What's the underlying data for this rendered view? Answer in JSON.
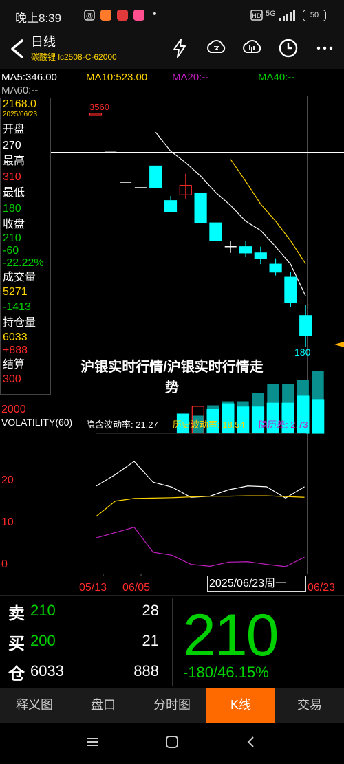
{
  "status": {
    "time": "晚上8:39",
    "network": "5G",
    "battery": "50"
  },
  "header": {
    "title": "日线",
    "subtitle": "碳酸锂 lc2508-C-62000",
    "icons": [
      "back-icon",
      "lightning-icon",
      "cloud-sync-icon",
      "cloud-sync-alt-icon",
      "clock-icon",
      "more-icon"
    ]
  },
  "indicators": {
    "ma5": "MA5:346.00",
    "ma10": "MA10:523.00",
    "ma20": "MA20:--",
    "ma40": "MA40:--",
    "ma60": "MA60:--"
  },
  "info": {
    "price": "2168.0",
    "date": "2025/06/23",
    "open_label": "开盘",
    "open": "270",
    "high_label": "最高",
    "high": "310",
    "low_label": "最低",
    "low": "180",
    "close_label": "收盘",
    "close": "210",
    "change": "-60",
    "change_pct": "-22.22%",
    "volume_label": "成交量",
    "volume": "5271",
    "volume_change": "-1413",
    "oi_label": "持仓量",
    "oi": "6033",
    "oi_change": "+888",
    "settle_label": "结算",
    "settle": "300"
  },
  "chart_labels": {
    "high_marker": "3560",
    "low_marker": "180",
    "volume_level": "2000",
    "vol_title": "VOLATILITY(60)",
    "implied": "隐含波动率: 21.27",
    "historical": "历史波动率: 18.54",
    "spread": "隐历差: 2.73",
    "tick_20": "20",
    "tick_10": "10",
    "tick_0": "0",
    "date_1": "05/13",
    "date_2": "06/05",
    "date_3": "06/23",
    "crosshair_date": "2025/06/23周一"
  },
  "chart_data": {
    "type": "candlestick",
    "candles": [
      {
        "open": 3540,
        "close": 3560,
        "high": 3560,
        "low": 3540
      },
      {
        "open": 2170,
        "close": 2170,
        "high": 2170,
        "low": 2170
      },
      {
        "open": 1480,
        "close": 1480,
        "high": 1480,
        "low": 1480
      },
      {
        "open": 1380,
        "close": 1380,
        "high": 1380,
        "low": 1380
      },
      {
        "open": 1820,
        "close": 1380,
        "high": 1820,
        "low": 1380
      },
      {
        "open": 1170,
        "close": 1020,
        "high": 1240,
        "low": 1020
      },
      {
        "open": 1260,
        "close": 1420,
        "high": 1650,
        "low": 1200
      },
      {
        "open": 1290,
        "close": 880,
        "high": 1290,
        "low": 880
      },
      {
        "open": 880,
        "close": 700,
        "high": 880,
        "low": 700
      },
      {
        "open": 650,
        "close": 650,
        "high": 700,
        "low": 600
      },
      {
        "open": 650,
        "close": 600,
        "high": 700,
        "low": 570
      },
      {
        "open": 600,
        "close": 560,
        "high": 650,
        "low": 520
      },
      {
        "open": 520,
        "close": 470,
        "high": 560,
        "low": 450
      },
      {
        "open": 440,
        "close": 320,
        "high": 470,
        "low": 300
      },
      {
        "open": 270,
        "close": 210,
        "high": 310,
        "low": 180
      }
    ],
    "ma5": [
      null,
      null,
      null,
      null,
      2800,
      2200,
      1900,
      1600,
      1300,
      1100,
      900,
      800,
      650,
      520,
      346
    ],
    "ma10": [
      null,
      null,
      null,
      null,
      null,
      null,
      null,
      null,
      null,
      1980,
      1500,
      1120,
      900,
      700,
      523
    ],
    "volume": [
      null,
      null,
      null,
      null,
      null,
      3000,
      4200,
      3700,
      4600,
      4100,
      4100,
      4700,
      4700,
      5800,
      5271
    ],
    "open_interest": [
      null,
      null,
      null,
      null,
      null,
      1700,
      1700,
      2700,
      3100,
      3100,
      3900,
      4800,
      4800,
      5200,
      6033
    ],
    "implied_volatility": [
      null,
      null,
      null,
      null,
      21.5,
      24.5,
      28.0,
      22.5,
      21.2,
      18.5,
      18.8,
      20.5,
      21.5,
      21.3,
      18.3,
      21.3
    ],
    "historical_volatility": [
      null,
      null,
      null,
      null,
      13.5,
      17.5,
      18.2,
      18.3,
      18.4,
      18.6,
      18.8,
      18.8,
      18.9,
      18.9,
      18.7,
      18.5
    ],
    "volatility_spread": [
      null,
      null,
      null,
      null,
      7.8,
      9.2,
      10.6,
      4.0,
      3.2,
      0.8,
      0.3,
      1.4,
      1.5,
      0.8,
      0.2,
      2.7
    ],
    "xlabels": [
      "05/13",
      "06/05",
      "06/23"
    ]
  },
  "headline": {
    "line1": "沪银实时行情/沪银实时行情走",
    "line2": "势"
  },
  "quote": {
    "sell_label": "卖",
    "sell_price": "210",
    "sell_qty": "28",
    "buy_label": "买",
    "buy_price": "200",
    "buy_qty": "21",
    "oi_label": "仓",
    "oi_value": "6033",
    "oi_change": "888",
    "last_price": "210",
    "change": "-180/46.15%"
  },
  "tabs": [
    "释义图",
    "盘口",
    "分时图",
    "K线",
    "交易"
  ],
  "colors": {
    "up": "#ff2a2a",
    "down": "#00ffff",
    "ma5": "#ffffff",
    "ma10": "#ffd400",
    "ma20": "#c020c0",
    "ma40": "#00d000",
    "active_tab": "#ff6a00"
  }
}
